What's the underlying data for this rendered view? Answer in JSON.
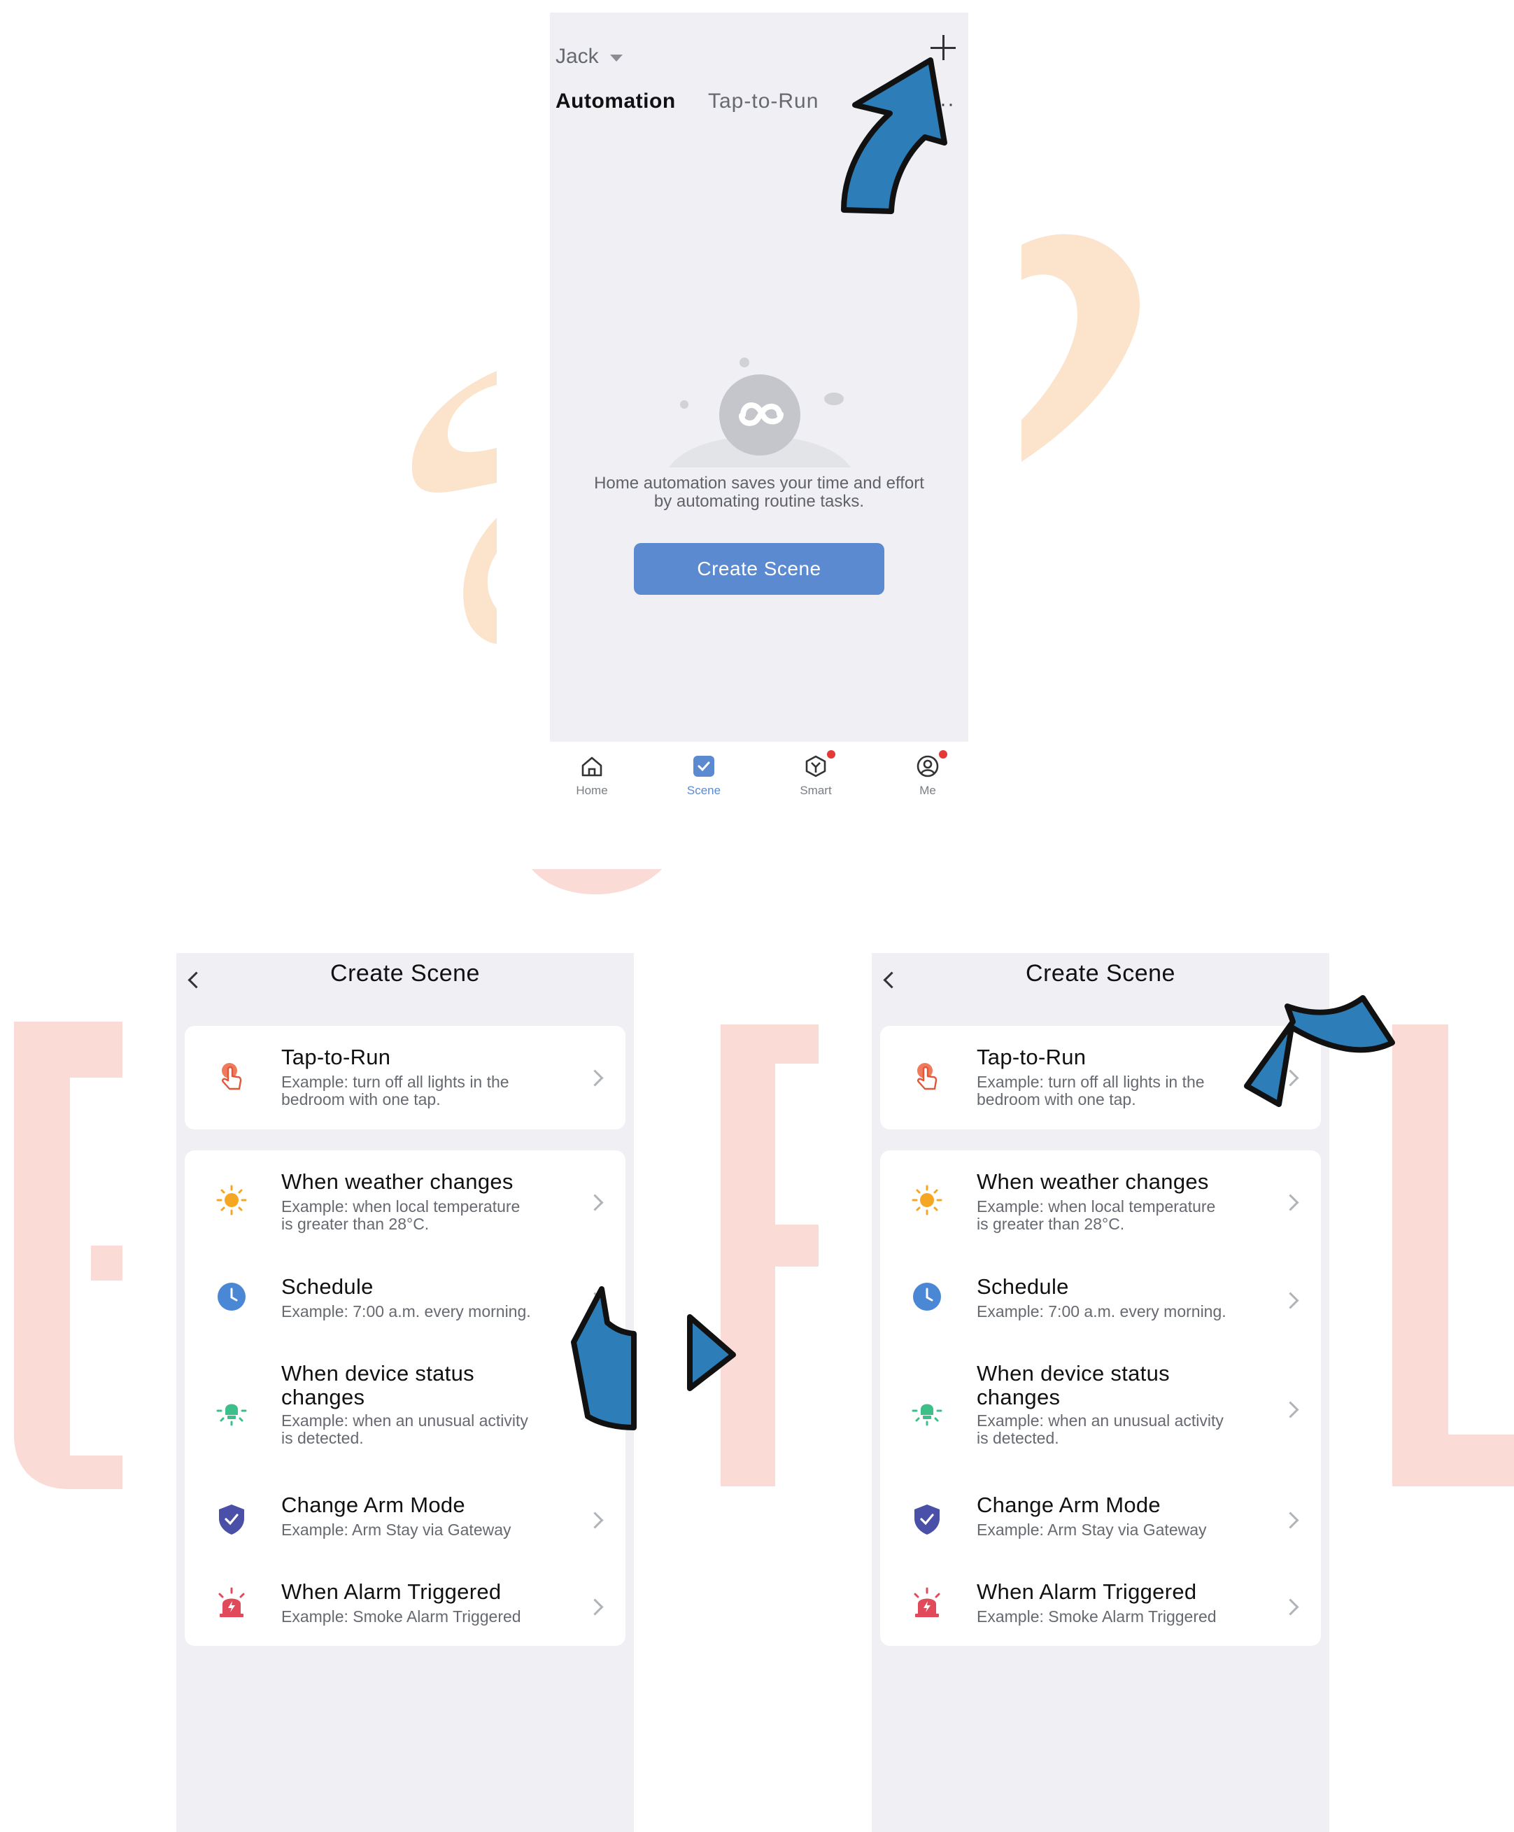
{
  "colors": {
    "accent": "#5b8ad0",
    "badge": "#e53935",
    "arrow": "#2c7db8",
    "watermark_orange": "#fbe3cc",
    "watermark_pink": "#fadbd6"
  },
  "top_screen": {
    "home_name": "Jack",
    "add_icon": "plus-icon",
    "tabs": [
      "Automation",
      "Tap-to-Run"
    ],
    "more_icon": "more-icon",
    "empty_state": {
      "line1": "Home automation saves your time and effort",
      "line2": "by automating routine tasks.",
      "button": "Create Scene"
    },
    "nav": [
      {
        "label": "Home",
        "icon": "home-icon",
        "active": false,
        "badge": false
      },
      {
        "label": "Scene",
        "icon": "scene-icon",
        "active": true,
        "badge": false
      },
      {
        "label": "Smart",
        "icon": "smart-icon",
        "active": false,
        "badge": true
      },
      {
        "label": "Me",
        "icon": "profile-icon",
        "active": false,
        "badge": true
      }
    ]
  },
  "scene": {
    "title": "Create Scene",
    "tap_to_run": {
      "title": "Tap-to-Run",
      "line1": "Example: turn off all lights in the",
      "line2": "bedroom with one tap.",
      "icon": "tap-icon"
    },
    "conditions": [
      {
        "title": "When weather changes",
        "line1": "Example: when local temperature",
        "line2": "is greater than 28°C.",
        "icon": "sun-icon"
      },
      {
        "title": "Schedule",
        "line1": "Example: 7:00 a.m. every morning.",
        "line2": "",
        "icon": "clock-icon"
      },
      {
        "title_line1": "When device status",
        "title_line2": "changes",
        "line1": "Example: when an unusual activity",
        "line2": "is detected.",
        "icon": "bulb-icon"
      },
      {
        "title": "Change Arm Mode",
        "line1": "Example: Arm Stay via Gateway",
        "line2": "",
        "icon": "shield-icon"
      },
      {
        "title": "When Alarm Triggered",
        "line1": "Example: Smoke Alarm Triggered",
        "line2": "",
        "icon": "alarm-icon"
      }
    ]
  }
}
